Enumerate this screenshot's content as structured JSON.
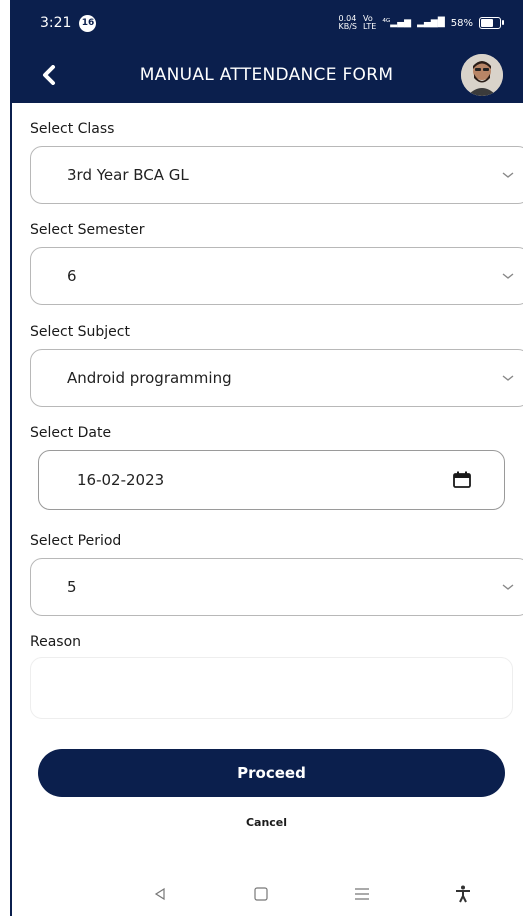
{
  "status_bar": {
    "time": "3:21",
    "notification_count": "16",
    "network_speed": "0.04\nKB/S",
    "battery_percent": "58%"
  },
  "header": {
    "title": "MANUAL ATTENDANCE FORM"
  },
  "form": {
    "class": {
      "label": "Select Class",
      "value": "3rd Year BCA GL"
    },
    "semester": {
      "label": "Select Semester",
      "value": "6"
    },
    "subject": {
      "label": "Select Subject",
      "value": "Android programming"
    },
    "date": {
      "label": "Select Date",
      "value": "16-02-2023"
    },
    "period": {
      "label": "Select Period",
      "value": "5"
    },
    "reason": {
      "label": "Reason",
      "value": ""
    }
  },
  "actions": {
    "proceed_label": "Proceed",
    "cancel_label": "Cancel"
  },
  "icons": {
    "back": "chevron-left-icon",
    "dropdown": "chevron-down-icon",
    "calendar": "calendar-icon",
    "nav_back": "triangle-back-icon",
    "nav_home": "square-home-icon",
    "nav_menu": "menu-lines-icon",
    "accessibility": "accessibility-icon"
  },
  "colors": {
    "primary": "#0b1f4d",
    "border": "#b8b8b8"
  }
}
